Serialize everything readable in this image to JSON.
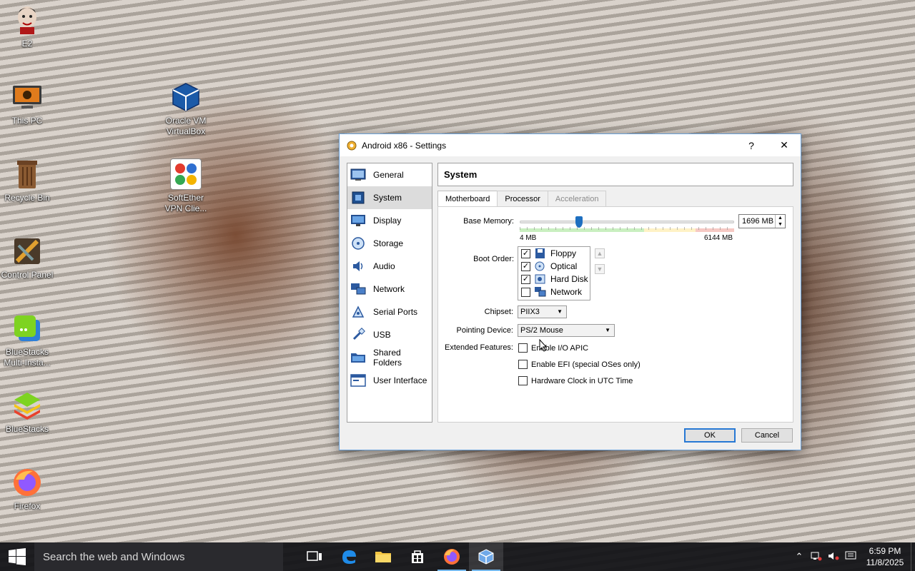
{
  "desktop": {
    "icons": [
      {
        "label": "E2",
        "icon": "cartoon-face-icon"
      },
      {
        "label": "This PC",
        "icon": "computer-icon"
      },
      {
        "label": "Recycle Bin",
        "icon": "recycle-bin-icon"
      },
      {
        "label": "Control Panel",
        "icon": "control-panel-icon"
      },
      {
        "label": "BlueStacks Multi-Insta...",
        "icon": "bluestacks-multi-icon"
      },
      {
        "label": "BlueStacks",
        "icon": "bluestacks-icon"
      },
      {
        "label": "Firefox",
        "icon": "firefox-icon"
      },
      {
        "label": "Oracle VM VirtualBox",
        "icon": "virtualbox-icon"
      },
      {
        "label": "SoftEther VPN Clie...",
        "icon": "softether-icon"
      }
    ]
  },
  "dialog": {
    "title": "Android x86 - Settings",
    "help": "?",
    "close": "✕",
    "sidebar": [
      {
        "label": "General",
        "icon": "general-icon"
      },
      {
        "label": "System",
        "icon": "system-icon",
        "active": true
      },
      {
        "label": "Display",
        "icon": "display-icon"
      },
      {
        "label": "Storage",
        "icon": "storage-icon"
      },
      {
        "label": "Audio",
        "icon": "audio-icon"
      },
      {
        "label": "Network",
        "icon": "network-icon"
      },
      {
        "label": "Serial Ports",
        "icon": "serial-ports-icon"
      },
      {
        "label": "USB",
        "icon": "usb-icon"
      },
      {
        "label": "Shared Folders",
        "icon": "shared-folders-icon"
      },
      {
        "label": "User Interface",
        "icon": "user-interface-icon"
      }
    ],
    "section_title": "System",
    "tabs": [
      {
        "label": "Motherboard",
        "active": true
      },
      {
        "label": "Processor"
      },
      {
        "label": "Acceleration",
        "disabled": true
      }
    ],
    "motherboard": {
      "base_memory_label": "Base Memory:",
      "base_memory_value": "1696 MB",
      "memory_min_label": "4 MB",
      "memory_max_label": "6144 MB",
      "memory_fraction": 0.276,
      "boot_order_label": "Boot Order:",
      "boot_order": [
        {
          "label": "Floppy",
          "checked": true,
          "icon": "floppy-icon"
        },
        {
          "label": "Optical",
          "checked": true,
          "icon": "optical-icon"
        },
        {
          "label": "Hard Disk",
          "checked": true,
          "icon": "hard-disk-icon"
        },
        {
          "label": "Network",
          "checked": false,
          "icon": "network-boot-icon"
        }
      ],
      "chipset_label": "Chipset:",
      "chipset_value": "PIIX3",
      "pointing_label": "Pointing Device:",
      "pointing_value": "PS/2 Mouse",
      "extended_label": "Extended Features:",
      "features": [
        {
          "label": "Enable I/O APIC",
          "checked": false
        },
        {
          "label": "Enable EFI (special OSes only)",
          "checked": false
        },
        {
          "label": "Hardware Clock in UTC Time",
          "checked": false
        }
      ]
    },
    "ok": "OK",
    "cancel": "Cancel"
  },
  "taskbar": {
    "search_placeholder": "Search the web and Windows",
    "time": "6:59 PM",
    "date": "11/8/2025"
  }
}
